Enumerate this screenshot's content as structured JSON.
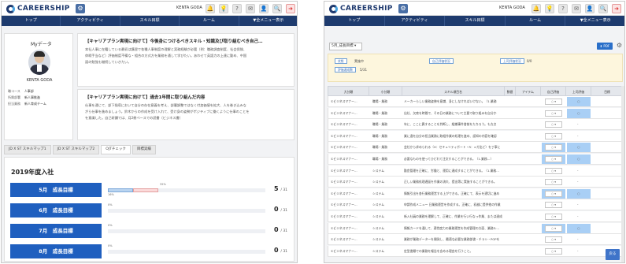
{
  "app": {
    "logo_text": "CAREERSHIP",
    "user_name": "KENTA GODA",
    "nav": [
      "トップ",
      "アクティビティ",
      "スキル目標",
      "ルーム",
      "▼全メニュー表示"
    ],
    "toolbar_icons": [
      "bell-icon",
      "lightbulb-icon",
      "help-icon",
      "mail-icon",
      "profile-icon",
      "search-icon",
      "logout-icon"
    ]
  },
  "left": {
    "mydata": {
      "title": "Myデータ",
      "name": "KENTA GODA",
      "info": [
        {
          "label": "職コース",
          "value": "人事部"
        },
        {
          "label": "所属部署",
          "value": "新人事推進"
        },
        {
          "label": "担当業務",
          "value": "新人育成チーム"
        }
      ]
    },
    "cards": [
      {
        "title": "【キャリアプラン実現に向けて】今後身につけるべきスキル・知識及び取り組むべき自己…",
        "lines": [
          "本社人事に在籍している最初は講習で各種人事制度の理解と実務経験が必要（例：職務調査制度、社会保険、",
          "休暇手当など）評価制度不備な・組合の方式方を業務を通して学びたい。あわせて英語力の上達に勤め、中国",
          "語の勉強も継続していきたい。"
        ]
      },
      {
        "title": "【キャリアプラン実現に向けて】過去1年間に取り組んだ内容",
        "lines": [
          "仕事を通じて、部下指導において自分の存在意義を考え、部署調整ではなく付加価値を拡大、人を巻き込みな",
          "がら仕事を進めましょう。鈴木からの作成を受け入れて、受け身の姿勢がポジティブに働くように仕事のことを",
          "を意識した。自己研鑽では、月2冊ペースでの読書（ビジネス書）"
        ]
      }
    ],
    "tabs": [
      "JD X ST スキルマップ1",
      "JD X ST スキルマップ2",
      "OJTチェック",
      "目標実績"
    ],
    "active_tab": "OJTチェック",
    "year_title": "2019年度入社",
    "goals": [
      {
        "label": "5月　成長目標",
        "score": "5",
        "total": "/ 31",
        "pct_a": "16%",
        "pct_b": "32%",
        "progress": 0.16,
        "progress_b": 0.32
      },
      {
        "label": "6月　成長目標",
        "score": "0",
        "total": "/ 31",
        "pct_a": "0%",
        "pct_b": "",
        "progress": 0.0,
        "progress_b": 0.0
      },
      {
        "label": "7月　成長目標",
        "score": "0",
        "total": "/ 31",
        "pct_a": "0%",
        "pct_b": "",
        "progress": 0.0,
        "progress_b": 0.0
      },
      {
        "label": "8月　成長目標",
        "score": "0",
        "total": "/ 31",
        "pct_a": "0%",
        "pct_b": "",
        "progress": 0.0,
        "progress_b": 0.0
      }
    ]
  },
  "right": {
    "period_select": "5月_成長目標",
    "pdf_label": "PDF",
    "filter": {
      "status_label": "状態",
      "status_value": "実施中",
      "self_label": "自己評価状況",
      "self_value": "",
      "boss_label": "上司評価状況",
      "boss_value": "0/0",
      "eval_label": "評価達成数",
      "eval_value": "5/31"
    },
    "columns": [
      "大分類",
      "小分類",
      "スキル項目名",
      "数値",
      "アイテム",
      "自己評価",
      "上司評価",
      "目標"
    ],
    "rows": [
      {
        "major": "①ビジネスマナー…",
        "minor": "職場・業務",
        "item": "メーカーらしい業務姿勢を意識、身にしなければいけない。（1.業務",
        "self": "○",
        "boss": "○",
        "blue_self": false,
        "blue_boss": true
      },
      {
        "major": "①ビジネスマナー…",
        "minor": "職場・業務",
        "item": "出社、欠席を時間で、その日の業務について主要で取り組みを自分か",
        "self": "○",
        "boss": "○",
        "blue_self": false,
        "blue_boss": true
      },
      {
        "major": "①ビジネスマナー…",
        "minor": "職場・業務",
        "item": "年に、ここに異することを判断し、組織事件書前をたちろう。も方点",
        "self": "○",
        "boss": "-",
        "blue_self": false,
        "blue_boss": false
      },
      {
        "major": "①ビジネスマナー…",
        "minor": "職場・業務",
        "item": "業に違を自分の担当業務に取組作業の処理を進め、認知の内容を確認",
        "self": "○",
        "boss": "-",
        "blue_self": false,
        "blue_boss": false
      },
      {
        "major": "①ビジネスマナー…",
        "minor": "職場・業務",
        "item": "会社から求められる（H：セキュリティポート・R：×ガ出ど）を丁寧に",
        "self": "○",
        "boss": "○",
        "blue_self": true,
        "blue_boss": true
      },
      {
        "major": "①ビジネスマナー…",
        "minor": "職場・業務",
        "item": "必要なものを使ってひどれて注文することができる。（1.業務…）",
        "self": "○",
        "boss": "○",
        "blue_self": true,
        "blue_boss": true
      },
      {
        "major": "①ビジネスマナー…",
        "minor": "システム",
        "item": "勤怠管理を正確に、労働と、運用に達成することができる。（1.業務…",
        "self": "○",
        "boss": "-",
        "blue_self": false,
        "blue_boss": false
      },
      {
        "major": "①ビジネスマナー…",
        "minor": "システム",
        "item": "正しい業務処理遅延を作業の流れ、提出等に実施することができる。",
        "self": "○",
        "boss": "-",
        "blue_self": false,
        "blue_boss": false
      },
      {
        "major": "①ビジネスマナー…",
        "minor": "システム",
        "item": "情報引出を各行業務運営する上ができる。正確にて、表示を適切に進め",
        "self": "○",
        "boss": "○",
        "blue_self": true,
        "blue_boss": true
      },
      {
        "major": "①ビジネスマナー…",
        "minor": "システム",
        "item": "申請作成メニュー 日業務運営を作成する。正確に、初越に提供他の作業",
        "self": "○",
        "boss": "-",
        "blue_self": false,
        "blue_boss": false
      },
      {
        "major": "①ビジネスマナー…",
        "minor": "システム",
        "item": "新入社員の業務を理解して、正確に、作業を行い行なっ作業、または達成",
        "self": "○",
        "boss": "-",
        "blue_self": false,
        "blue_boss": false
      },
      {
        "major": "①ビジネスマナー…",
        "minor": "システム",
        "item": "情報カードを通して、適性度力の業務運営を作成管理の方面、業務ル…",
        "self": "○",
        "boss": "○",
        "blue_self": true,
        "blue_boss": true
      },
      {
        "major": "①ビジネスマナー…",
        "minor": "システム",
        "item": "業務が業務データーを開発し、最適な必要な業務部書・チラシ・POPを",
        "self": "○",
        "boss": "-",
        "blue_self": false,
        "blue_boss": false
      },
      {
        "major": "①ビジネスマナー…",
        "minor": "システム",
        "item": "定型書類での業務を報告を含める理由を行うこと。",
        "self": "○",
        "boss": "-",
        "blue_self": false,
        "blue_boss": false
      }
    ],
    "back_label": "戻る"
  }
}
